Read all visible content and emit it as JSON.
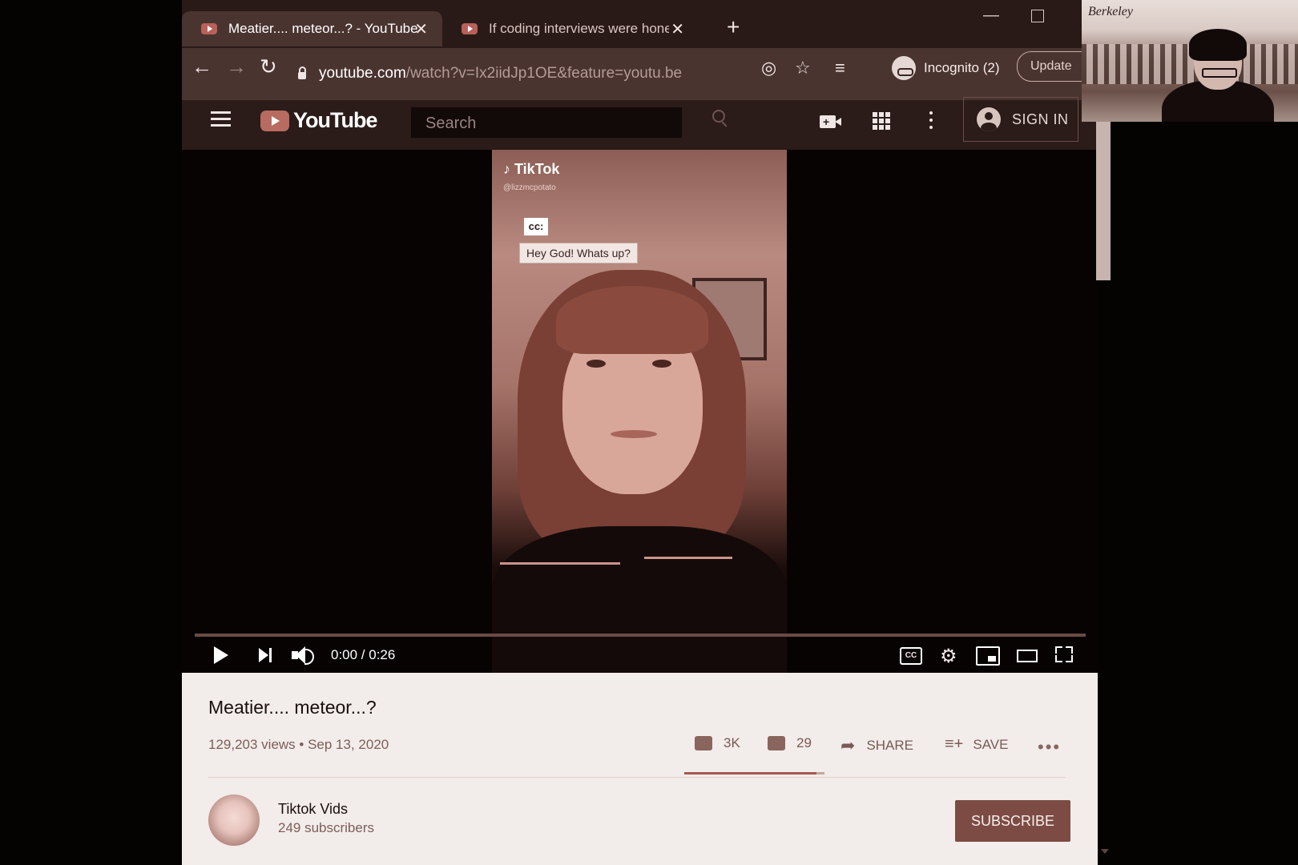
{
  "browser": {
    "tabs": [
      {
        "title": "Meatier.... meteor...? - YouTube",
        "active": true
      },
      {
        "title": "If coding interviews were honest",
        "active": false
      }
    ],
    "url_host": "youtube.com",
    "url_path": "/watch?v=Ix2iidJp1OE&feature=youtu.be",
    "incognito_label": "Incognito (2)",
    "update_label": "Update"
  },
  "youtube": {
    "logo_text": "YouTube",
    "search_placeholder": "Search",
    "sign_in": "SIGN IN"
  },
  "video_overlay": {
    "tiktok_logo": "TikTok",
    "tiktok_user": "@lizzmcpotato",
    "cc_tag": "cc:",
    "caption": "Hey God! Whats up?"
  },
  "player": {
    "time": "0:00 / 0:26",
    "progress_fraction": 0.0,
    "cc_label": "CC"
  },
  "video_info": {
    "title": "Meatier.... meteor...?",
    "views_date": "129,203 views • Sep 13, 2020",
    "likes": "3K",
    "dislikes": "29",
    "share": "SHARE",
    "save": "SAVE",
    "more": "•••"
  },
  "channel": {
    "name": "Tiktok Vids",
    "subscribers": "249 subscribers",
    "subscribe_label": "SUBSCRIBE"
  },
  "webcam": {
    "background_text": "Berkeley"
  },
  "colors": {
    "youtube_red": "#b86b60",
    "subscribe_bg": "#7c4c44",
    "header_bg": "#2b1b19"
  }
}
